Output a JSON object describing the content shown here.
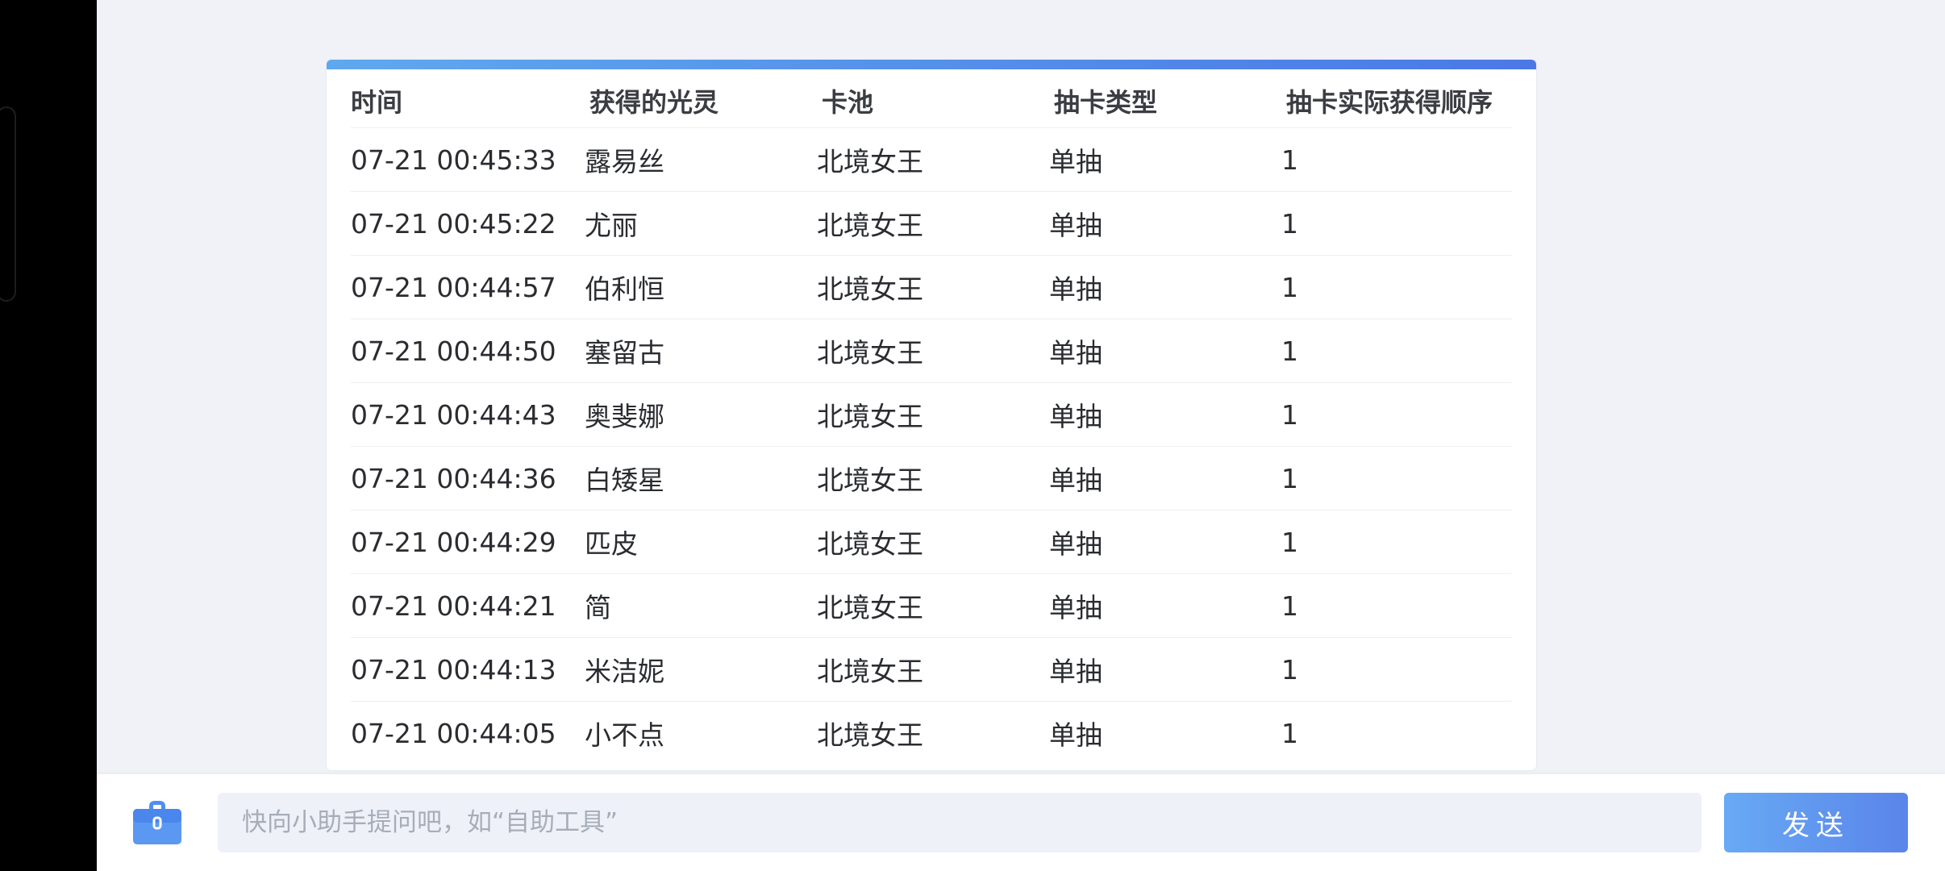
{
  "table": {
    "headers": [
      "时间",
      "获得的光灵",
      "卡池",
      "抽卡类型",
      "抽卡实际获得顺序"
    ],
    "rows": [
      [
        "07-21 00:45:33",
        "露易丝",
        "北境女王",
        "单抽",
        "1"
      ],
      [
        "07-21 00:45:22",
        "尤丽",
        "北境女王",
        "单抽",
        "1"
      ],
      [
        "07-21 00:44:57",
        "伯利恒",
        "北境女王",
        "单抽",
        "1"
      ],
      [
        "07-21 00:44:50",
        "塞留古",
        "北境女王",
        "单抽",
        "1"
      ],
      [
        "07-21 00:44:43",
        "奥斐娜",
        "北境女王",
        "单抽",
        "1"
      ],
      [
        "07-21 00:44:36",
        "白矮星",
        "北境女王",
        "单抽",
        "1"
      ],
      [
        "07-21 00:44:29",
        "匹皮",
        "北境女王",
        "单抽",
        "1"
      ],
      [
        "07-21 00:44:21",
        "简",
        "北境女王",
        "单抽",
        "1"
      ],
      [
        "07-21 00:44:13",
        "米洁妮",
        "北境女王",
        "单抽",
        "1"
      ],
      [
        "07-21 00:44:05",
        "小不点",
        "北境女王",
        "单抽",
        "1"
      ]
    ]
  },
  "chat": {
    "input_placeholder": "快向小助手提问吧，如“自助工具”",
    "input_value": "",
    "send_label": "发送",
    "toolbox_icon": "toolbox-icon"
  },
  "colors": {
    "accent_start": "#5fa8ee",
    "accent_end": "#4b78e6",
    "toolbox_blue": "#4f8ef0"
  }
}
